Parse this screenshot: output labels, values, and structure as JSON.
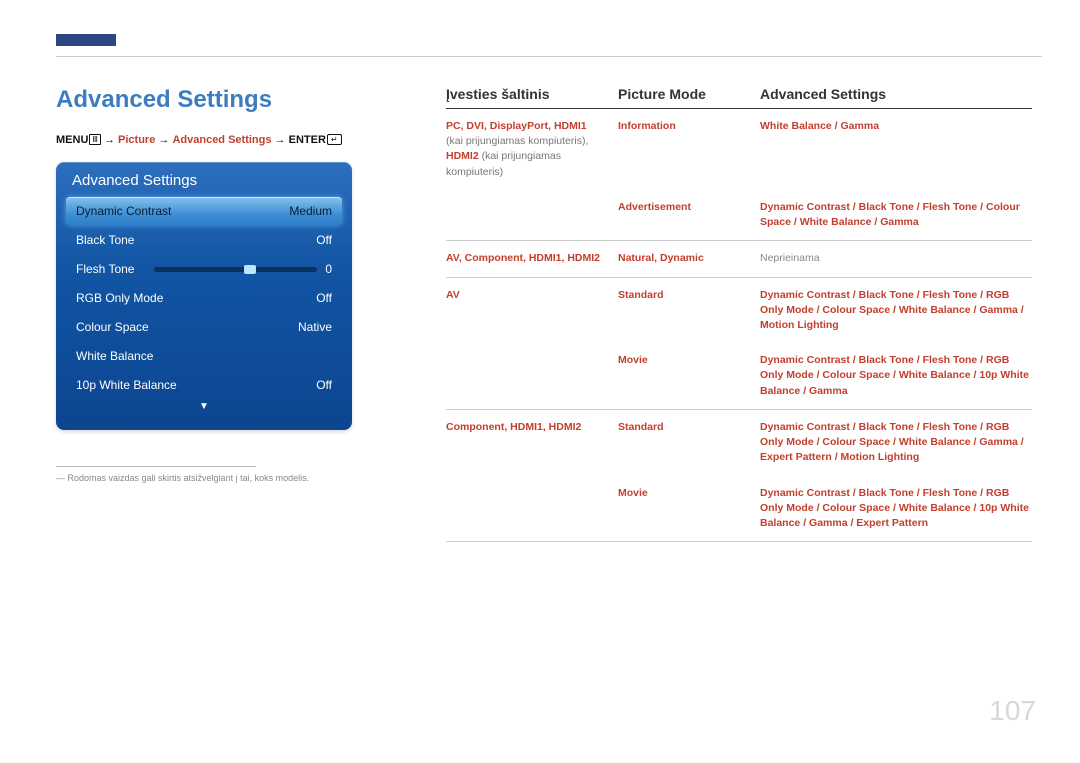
{
  "page_number": "107",
  "heading": "Advanced Settings",
  "breadcrumb": {
    "menu": "MENU",
    "picture": "Picture",
    "advanced": "Advanced Settings",
    "enter": "ENTER"
  },
  "panel": {
    "title": "Advanced Settings",
    "rows": [
      {
        "label": "Dynamic Contrast",
        "value": "Medium",
        "selected": true
      },
      {
        "label": "Black Tone",
        "value": "Off"
      },
      {
        "label": "Flesh Tone",
        "value": "0",
        "slider": true
      },
      {
        "label": "RGB Only Mode",
        "value": "Off"
      },
      {
        "label": "Colour Space",
        "value": "Native"
      },
      {
        "label": "White Balance",
        "value": ""
      },
      {
        "label": "10p White Balance",
        "value": "Off"
      }
    ]
  },
  "footnote": "― Rodomas vaizdas gali skirtis atsižvelgiant į tai, koks modelis.",
  "table": {
    "headers": [
      "Įvesties šaltinis",
      "Picture Mode",
      "Advanced Settings"
    ],
    "rows": [
      {
        "source_bold": "PC, DVI, DisplayPort, HDMI1",
        "source_plain1": "(kai prijungiamas kompiuteris),",
        "source_bold2": "HDMI2",
        "source_plain2": " (kai prijungiamas kompiuteris)",
        "mode_rows": [
          {
            "mode": "Information",
            "settings": "White Balance / Gamma"
          },
          {
            "mode": "Advertisement",
            "settings": "Dynamic Contrast / Black Tone / Flesh Tone / Colour Space / White Balance / Gamma"
          }
        ]
      },
      {
        "source_bold": "AV, Component, HDMI1, HDMI2",
        "mode_rows": [
          {
            "mode": "Natural, Dynamic",
            "settings_gray": "Neprieinama"
          }
        ]
      },
      {
        "source_bold": "AV",
        "mode_rows": [
          {
            "mode": "Standard",
            "settings": "Dynamic Contrast / Black Tone / Flesh Tone / RGB Only Mode / Colour Space / White Balance / Gamma / Motion Lighting"
          },
          {
            "mode": "Movie",
            "settings": "Dynamic Contrast / Black Tone / Flesh Tone / RGB Only Mode / Colour Space / White Balance / 10p White Balance / Gamma"
          }
        ]
      },
      {
        "source_bold": "Component, HDMI1, HDMI2",
        "mode_rows": [
          {
            "mode": "Standard",
            "settings": "Dynamic Contrast / Black Tone / Flesh Tone / RGB Only Mode / Colour Space / White Balance / Gamma / Expert Pattern / Motion Lighting"
          },
          {
            "mode": "Movie",
            "settings": "Dynamic Contrast / Black Tone / Flesh Tone / RGB Only Mode / Colour Space / White Balance / 10p White Balance / Gamma / Expert Pattern"
          }
        ]
      }
    ]
  }
}
